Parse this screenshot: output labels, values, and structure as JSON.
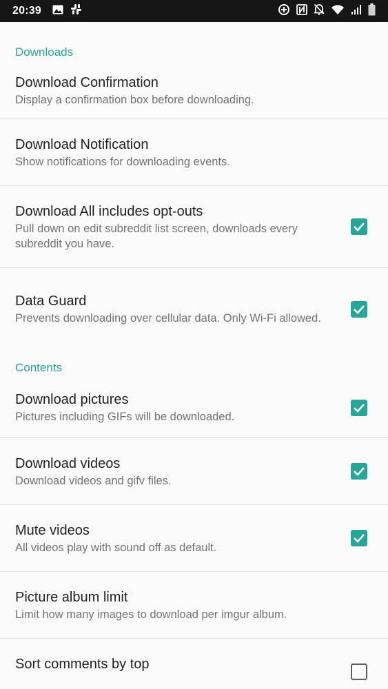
{
  "status_bar": {
    "time": "20:39",
    "left_icons": [
      "image-icon",
      "slack-icon"
    ],
    "right_icons": [
      "data-saver-icon",
      "nfc-icon",
      "bell-off-icon",
      "wifi-icon",
      "signal-icon",
      "battery-icon"
    ]
  },
  "sections": [
    {
      "header": "Downloads"
    },
    {
      "header": "Contents"
    }
  ],
  "settings": [
    {
      "title": "Download Confirmation",
      "summary": "Display a confirmation box before downloading."
    },
    {
      "title": "Download Notification",
      "summary": "Show notifications for downloading events."
    },
    {
      "title": "Download All includes opt-outs",
      "summary": "Pull down on edit subreddit list screen, downloads every subreddit you have.",
      "checked": true
    },
    {
      "title": "Data Guard",
      "summary": "Prevents downloading over cellular data. Only Wi-Fi allowed.",
      "checked": true
    },
    {
      "title": "Download pictures",
      "summary": "Pictures including GIFs will be downloaded.",
      "checked": true
    },
    {
      "title": "Download videos",
      "summary": "Download videos and gifv files.",
      "checked": true
    },
    {
      "title": "Mute videos",
      "summary": "All videos play with sound off as default.",
      "checked": true
    },
    {
      "title": "Picture album limit",
      "summary": "Limit how many images to download per imgur album."
    },
    {
      "title": "Sort comments by top",
      "summary": "",
      "checked": false
    }
  ],
  "colors": {
    "accent": "#26a69a",
    "status_bar": "#161616",
    "background": "#fafafa"
  }
}
